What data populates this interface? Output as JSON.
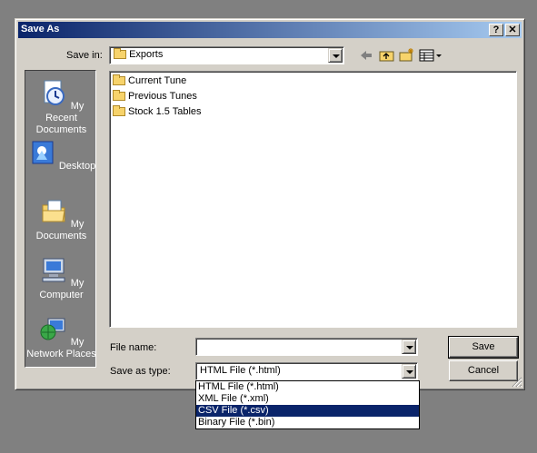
{
  "window": {
    "title": "Save As",
    "help_btn": "?",
    "close_btn": "✕"
  },
  "toolbar": {
    "save_in_label": "Save in:",
    "save_in_value": "Exports"
  },
  "places": [
    {
      "label": "My Recent Documents",
      "icon": "recent-documents-icon"
    },
    {
      "label": "Desktop",
      "icon": "desktop-icon"
    },
    {
      "label": "My Documents",
      "icon": "my-documents-icon"
    },
    {
      "label": "My Computer",
      "icon": "my-computer-icon"
    },
    {
      "label": "My Network Places",
      "icon": "network-places-icon"
    }
  ],
  "files": [
    {
      "name": "Current Tune",
      "type": "folder"
    },
    {
      "name": "Previous Tunes",
      "type": "folder"
    },
    {
      "name": "Stock 1.5 Tables",
      "type": "folder"
    }
  ],
  "form": {
    "file_name_label": "File name:",
    "file_name_value": "",
    "type_label": "Save as type:",
    "type_value": "HTML File (*.html)"
  },
  "buttons": {
    "save": "Save",
    "cancel": "Cancel"
  },
  "type_options": [
    {
      "label": "HTML File (*.html)",
      "selected": false
    },
    {
      "label": "XML File (*.xml)",
      "selected": false
    },
    {
      "label": "CSV File (*.csv)",
      "selected": true
    },
    {
      "label": "Binary File (*.bin)",
      "selected": false
    }
  ],
  "colors": {
    "title_gradient_start": "#0a246a",
    "title_gradient_end": "#a6caf0",
    "selection": "#0a246a",
    "face": "#d4d0c8",
    "desktop": "#808080"
  }
}
